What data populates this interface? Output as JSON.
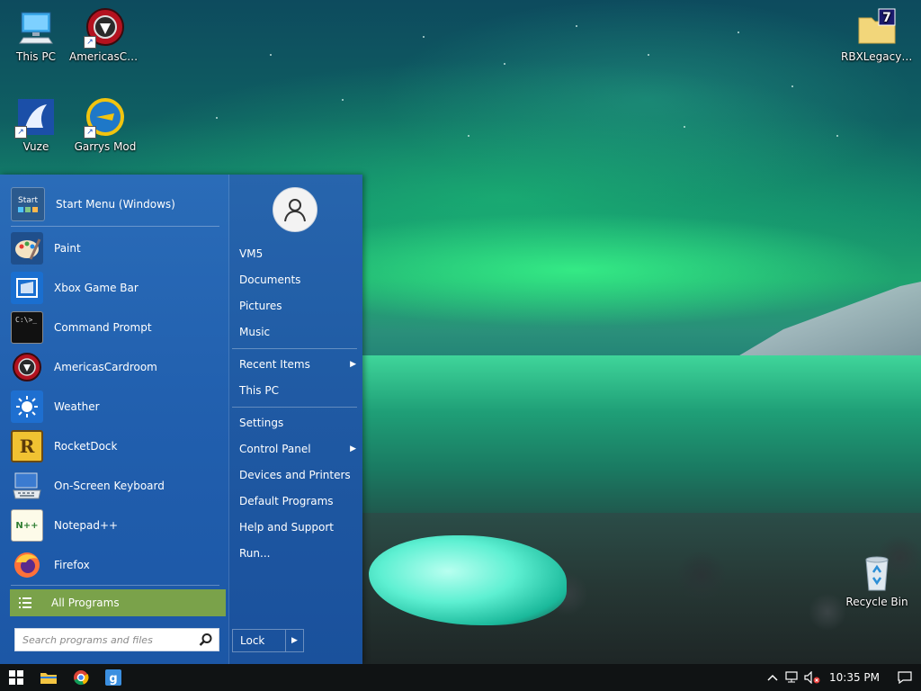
{
  "desktop": {
    "icons": [
      {
        "label": "This PC"
      },
      {
        "label": "AmericasCa..."
      },
      {
        "label": "RBXLegacy_..."
      },
      {
        "label": "Vuze"
      },
      {
        "label": "Garrys Mod"
      },
      {
        "label": "Recycle Bin"
      }
    ]
  },
  "start_menu": {
    "header_item": {
      "label": "Start Menu (Windows)",
      "icon_text": "Start"
    },
    "pinned": [
      {
        "label": "Paint",
        "icon": "paint-icon"
      },
      {
        "label": "Xbox Game Bar",
        "icon": "xbox-game-bar-icon"
      },
      {
        "label": "Command Prompt",
        "icon": "command-prompt-icon",
        "icon_text": "C:\\>_"
      },
      {
        "label": "AmericasCardroom",
        "icon": "americascardroom-icon"
      },
      {
        "label": "Weather",
        "icon": "weather-icon"
      },
      {
        "label": "RocketDock",
        "icon": "rocketdock-icon",
        "icon_text": "R"
      },
      {
        "label": "On-Screen Keyboard",
        "icon": "keyboard-icon"
      },
      {
        "label": "Notepad++",
        "icon": "notepad-plus-plus-icon",
        "icon_text": "N++"
      },
      {
        "label": "Firefox",
        "icon": "firefox-icon"
      }
    ],
    "all_programs": "All Programs",
    "search": {
      "placeholder": "Search programs and files",
      "value": ""
    },
    "right": {
      "user_name": "VM5",
      "items": [
        {
          "label": "Documents"
        },
        {
          "label": "Pictures"
        },
        {
          "label": "Music"
        },
        {
          "label": "Recent Items",
          "submenu": true
        },
        {
          "label": "This PC"
        },
        {
          "label": "Settings"
        },
        {
          "label": "Control Panel",
          "submenu": true
        },
        {
          "label": "Devices and Printers"
        },
        {
          "label": "Default Programs"
        },
        {
          "label": "Help and Support"
        },
        {
          "label": "Run..."
        }
      ],
      "lock": "Lock"
    }
  },
  "taskbar": {
    "clock": "10:35 PM"
  },
  "colors": {
    "start_menu_bg": "#215fae",
    "all_programs_bg": "#7aa24a",
    "taskbar_bg": "#101314"
  }
}
